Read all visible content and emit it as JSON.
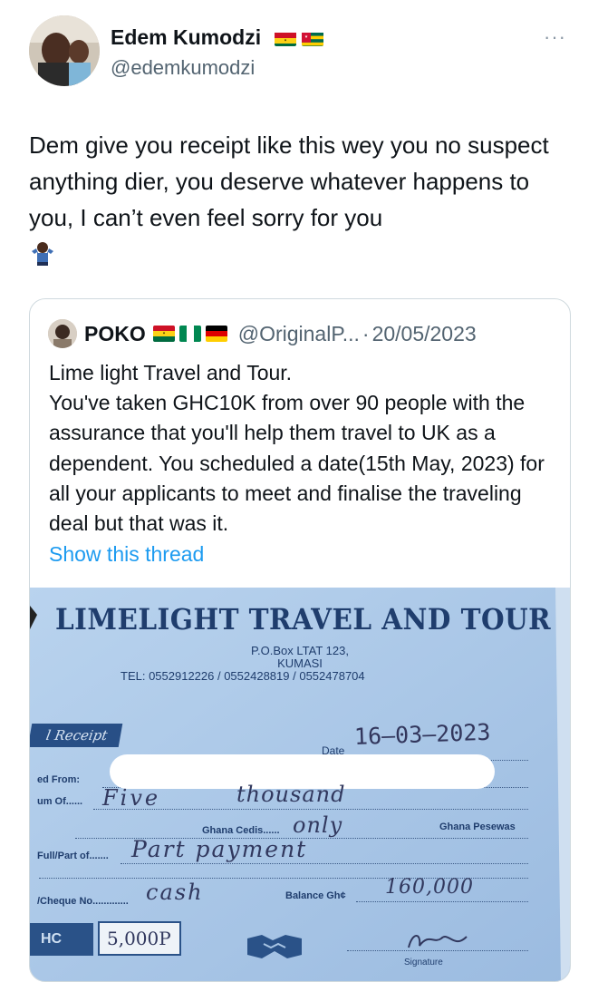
{
  "tweet": {
    "author_name": "Edem Kumodzi",
    "author_handle": "@edemkumodzi",
    "author_flags": [
      "ghana-flag",
      "togo-flag"
    ],
    "more_menu": "···",
    "text": "Dem give you receipt like this wey you no suspect anything dier, you deserve whatever happens to you, I can’t even feel sorry for you",
    "emoji": "person-shrugging-emoji"
  },
  "quote": {
    "author_name": "POKO",
    "author_flags": [
      "ghana-flag",
      "nigeria-flag",
      "germany-flag"
    ],
    "handle": "@OriginalP...",
    "separator": "·",
    "date": "20/05/2023",
    "text": "Lime light Travel and Tour.\nYou've taken GHC10K from over 90 people with the assurance that you'll help them travel to UK as a dependent. You scheduled a date(15th May, 2023) for all your applicants to meet and finalise the traveling deal but that was it.",
    "show_thread": "Show this thread"
  },
  "receipt_image": {
    "company": "LIMELIGHT TRAVEL AND TOUR",
    "address_line1": "P.O.Box LTAT 123,",
    "address_line2": "KUMASI",
    "tel": "TEL: 0552912226 / 0552428819 / 0552478704",
    "receipt_label": "l Receipt",
    "date_label": "Date",
    "date_value": "16—03—2023",
    "received_from_label": "ed From:",
    "sum_of_label": "um Of......",
    "sum_words_1": "Five",
    "sum_words_2": "thousand",
    "ghana_cedis_label": "Ghana Cedis......",
    "only_text": "only",
    "ghana_pesewas_label": "Ghana Pesewas",
    "full_part_label": "Full/Part of.......",
    "full_part_value": "Part payment",
    "cheque_label": "/Cheque No.............",
    "cheque_value": "cash",
    "balance_label": "Balance Gh¢",
    "balance_value": "160,000",
    "hc_label": "HC",
    "amount_value": "5,000P",
    "signature_label": "Signature"
  },
  "colors": {
    "text": "#0f1419",
    "secondary": "#536471",
    "link": "#1d9bf0",
    "border": "#cfd9de",
    "receipt_paper": "#a8c5e4",
    "receipt_ink": "#1f3d6d"
  }
}
